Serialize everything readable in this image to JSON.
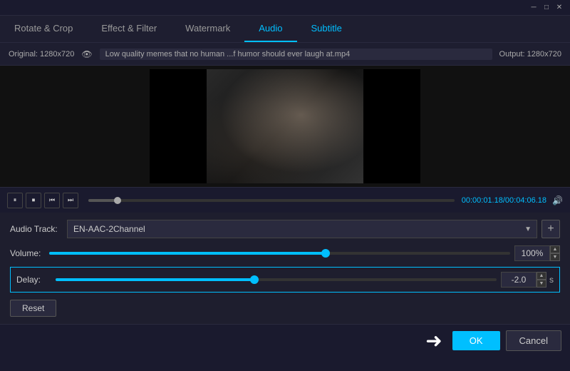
{
  "titlebar": {
    "minimize_label": "─",
    "maximize_label": "□",
    "close_label": "✕"
  },
  "tabs": [
    {
      "id": "rotate-crop",
      "label": "Rotate & Crop",
      "active": false
    },
    {
      "id": "effect-filter",
      "label": "Effect & Filter",
      "active": false
    },
    {
      "id": "watermark",
      "label": "Watermark",
      "active": false
    },
    {
      "id": "audio",
      "label": "Audio",
      "active": true
    },
    {
      "id": "subtitle",
      "label": "Subtitle",
      "active": false
    }
  ],
  "infobar": {
    "original_label": "Original: 1280x720",
    "filename": "Low quality memes that no human ...f humor should ever laugh at.mp4",
    "output_label": "Output: 1280x720"
  },
  "playback": {
    "time_current": "00:00:01.18",
    "time_separator": "/",
    "time_total": "00:04:06.18"
  },
  "audio": {
    "track_label": "Audio Track:",
    "track_value": "EN-AAC-2Channel",
    "add_label": "+",
    "volume_label": "Volume:",
    "volume_value": "100%",
    "delay_label": "Delay:",
    "delay_value": "-2.0",
    "delay_unit": "s",
    "reset_label": "Reset"
  },
  "footer": {
    "ok_label": "OK",
    "cancel_label": "Cancel"
  }
}
